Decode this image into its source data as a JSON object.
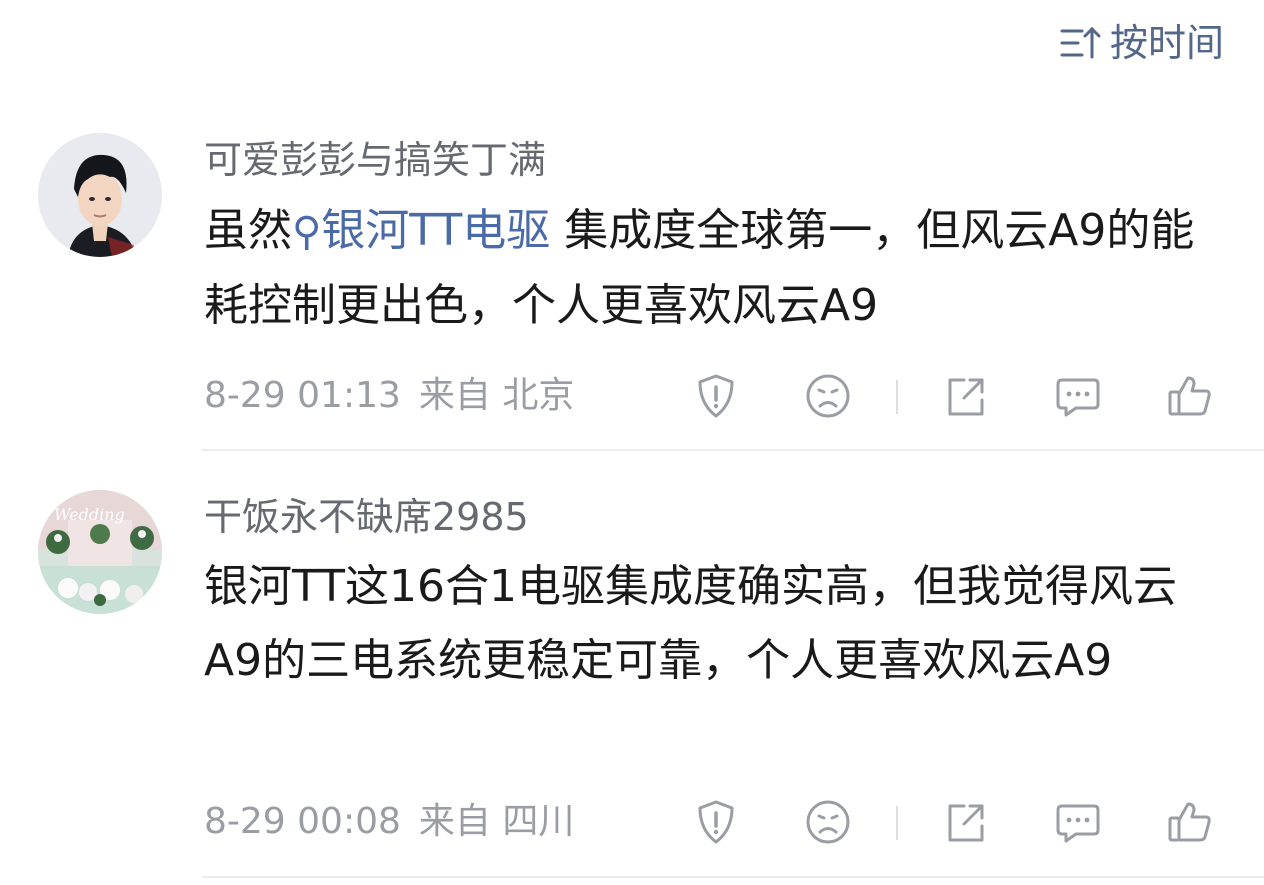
{
  "sort": {
    "label": "按时间",
    "icon": "sort-time-icon",
    "color": "#52678a"
  },
  "comments": [
    {
      "username": "可爱彭彭与搞笑丁满",
      "text_before": "虽然",
      "topic": {
        "icon": "search-icon",
        "label": "银河TT电驱"
      },
      "text_after": " 集成度全球第一，但风云A9的能耗控制更出色，个人更喜欢风云A9",
      "time": "8-29 01:13",
      "location": "来自 北京",
      "actions": [
        "report-icon",
        "dislike-icon",
        "share-icon",
        "comment-icon",
        "like-icon"
      ]
    },
    {
      "username": "干饭永不缺席2985",
      "text": "银河TT这16合1电驱集成度确实高，但我觉得风云A9的三电系统更稳定可靠，个人更喜欢风云A9",
      "time": "8-29 00:08",
      "location": "来自 四川",
      "avatar_text": "Wedding",
      "actions": [
        "report-icon",
        "dislike-icon",
        "share-icon",
        "comment-icon",
        "like-icon"
      ]
    }
  ],
  "colors": {
    "link": "#4a6aa8",
    "meta": "#9a9da3",
    "username": "#666a70"
  }
}
